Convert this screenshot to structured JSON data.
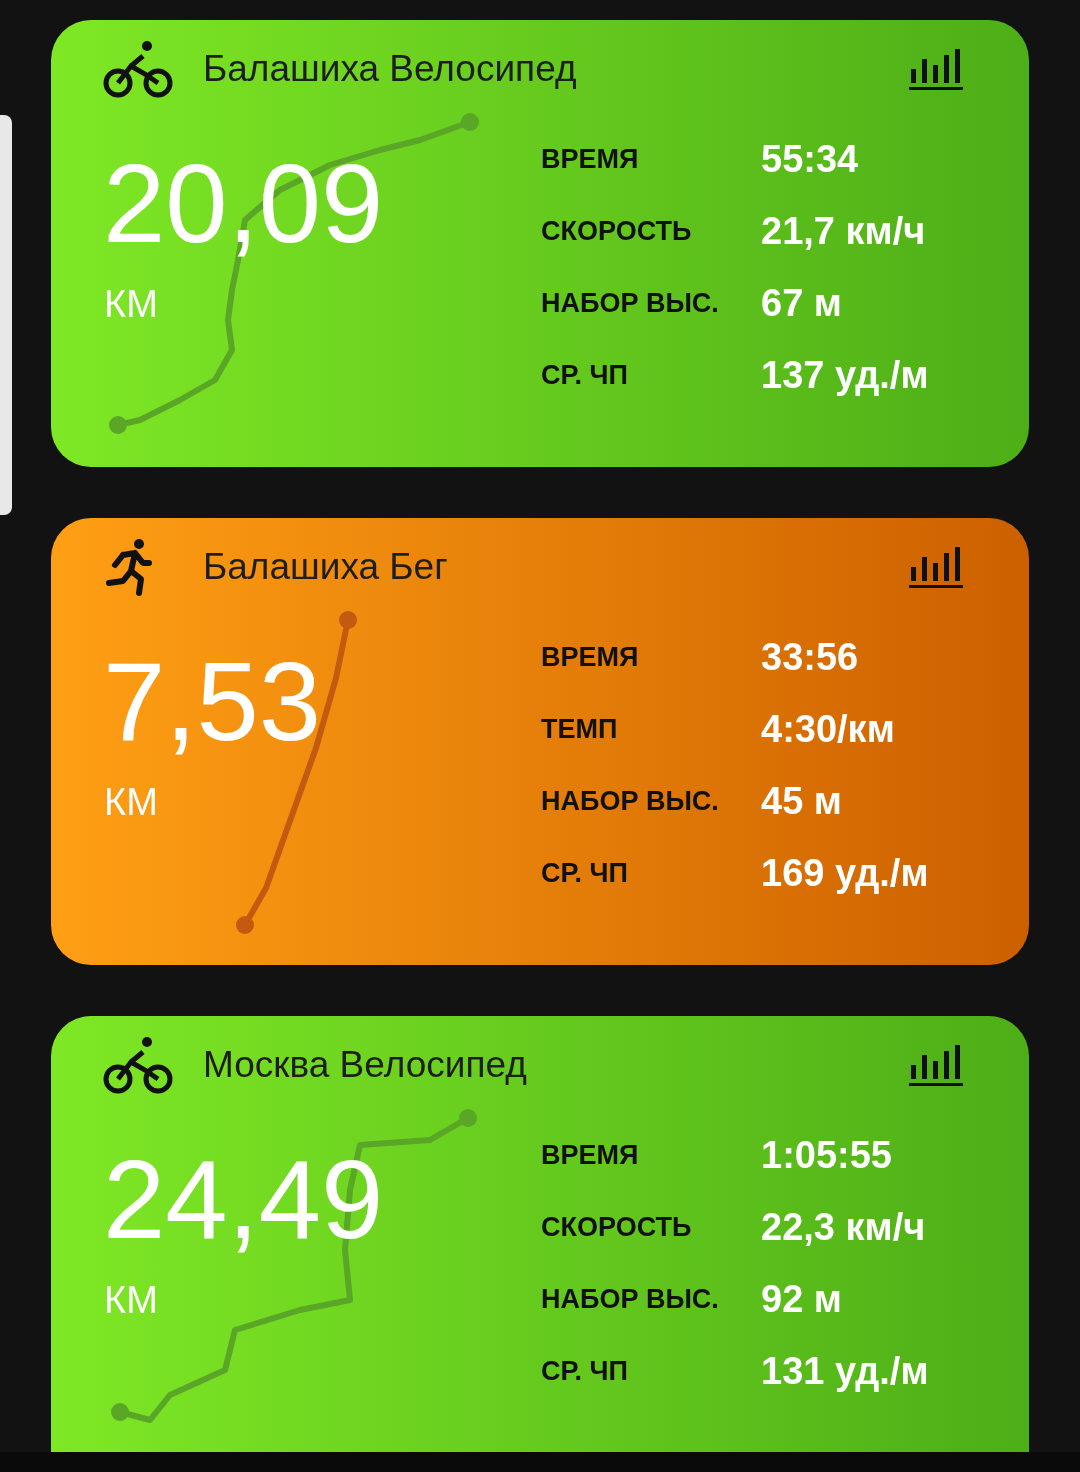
{
  "cards": [
    {
      "kind": "bike",
      "title": "Балашиха Велосипед",
      "distance": "20,09",
      "unit": "КМ",
      "stats": [
        {
          "label": "ВРЕМЯ",
          "value": "55:34"
        },
        {
          "label": "СКОРОСТЬ",
          "value": "21,7 км/ч"
        },
        {
          "label": "НАБОР ВЫС.",
          "value": "67 м"
        },
        {
          "label": "СР. ЧП",
          "value": "137 уд./м"
        }
      ]
    },
    {
      "kind": "run",
      "title": "Балашиха Бег",
      "distance": "7,53",
      "unit": "КМ",
      "stats": [
        {
          "label": "ВРЕМЯ",
          "value": "33:56"
        },
        {
          "label": "ТЕМП",
          "value": "4:30/км"
        },
        {
          "label": "НАБОР ВЫС.",
          "value": "45 м"
        },
        {
          "label": "СР. ЧП",
          "value": "169 уд./м"
        }
      ]
    },
    {
      "kind": "bike",
      "title": "Москва Велосипед",
      "distance": "24,49",
      "unit": "КМ",
      "stats": [
        {
          "label": "ВРЕМЯ",
          "value": "1:05:55"
        },
        {
          "label": "СКОРОСТЬ",
          "value": "22,3 км/ч"
        },
        {
          "label": "НАБОР ВЫС.",
          "value": "92 м"
        },
        {
          "label": "СР. ЧП",
          "value": "131 уд./м"
        }
      ]
    }
  ]
}
